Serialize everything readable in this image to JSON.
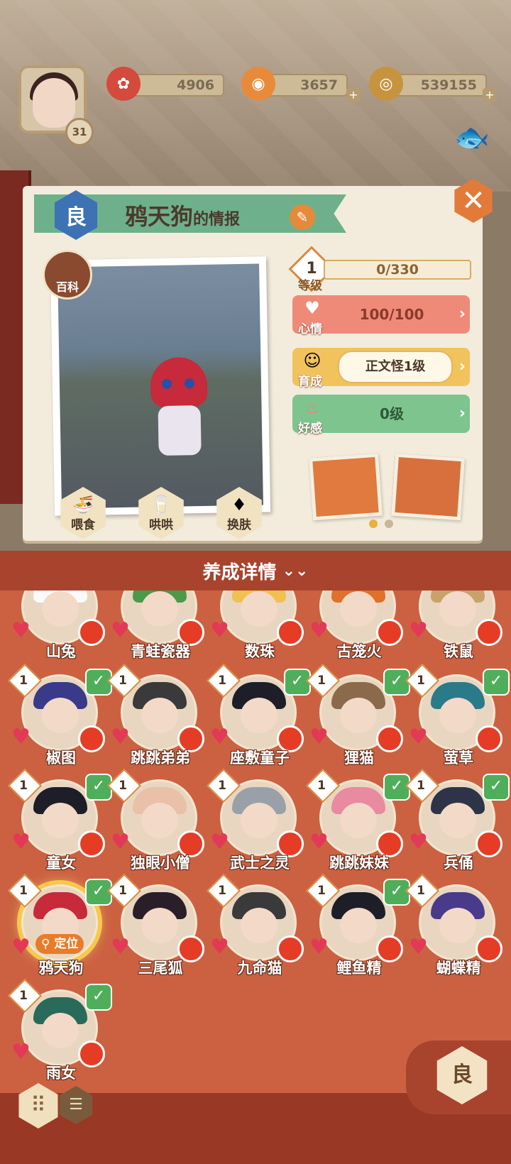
{
  "player": {
    "level": "31"
  },
  "resources": [
    {
      "name": "plum-token",
      "value": "4906",
      "color": "#d44a3c"
    },
    {
      "name": "soul-jade",
      "value": "3657",
      "color": "#e88a3a"
    },
    {
      "name": "coins",
      "value": "539155",
      "color": "#c6943f"
    }
  ],
  "info": {
    "rank": "良",
    "name": "鸦天狗",
    "suffix": "的情报",
    "close": "✕",
    "baike": "百科"
  },
  "actions": [
    {
      "label": "喂食",
      "icon": "bowl-icon"
    },
    {
      "label": "哄哄",
      "icon": "milk-icon"
    },
    {
      "label": "换肤",
      "icon": "skin-icon"
    }
  ],
  "stats": {
    "level": {
      "num": "1",
      "label": "等级",
      "value": "0/330"
    },
    "mood": {
      "label": "心情",
      "value": "100/100",
      "color": "#f08a78"
    },
    "growth": {
      "label": "育成",
      "value": "正文怪1级",
      "color": "#f2c25c"
    },
    "favor": {
      "label": "好感",
      "value": "0级",
      "color": "#7ec48f"
    }
  },
  "section": {
    "title": "养成详情"
  },
  "monsters": [
    {
      "name": "山兔",
      "level": "",
      "checked": false,
      "hair": "#fafafa"
    },
    {
      "name": "青蛙瓷器",
      "level": "",
      "checked": false,
      "hair": "#4a9a4a"
    },
    {
      "name": "数珠",
      "level": "",
      "checked": false,
      "hair": "#f0c050"
    },
    {
      "name": "古笼火",
      "level": "",
      "checked": false,
      "hair": "#e0702a"
    },
    {
      "name": "铁鼠",
      "level": "",
      "checked": false,
      "hair": "#c8a26a"
    },
    {
      "name": "椒图",
      "level": "1",
      "checked": true,
      "hair": "#3a3a8a"
    },
    {
      "name": "跳跳弟弟",
      "level": "1",
      "checked": false,
      "hair": "#3a3a3a"
    },
    {
      "name": "座敷童子",
      "level": "1",
      "checked": true,
      "hair": "#1e1e28"
    },
    {
      "name": "狸猫",
      "level": "1",
      "checked": true,
      "hair": "#8a6a4a"
    },
    {
      "name": "萤草",
      "level": "1",
      "checked": true,
      "hair": "#2a7a8a"
    },
    {
      "name": "童女",
      "level": "1",
      "checked": true,
      "hair": "#1e1e28"
    },
    {
      "name": "独眼小僧",
      "level": "1",
      "checked": false,
      "hair": "#e9c0a8"
    },
    {
      "name": "武士之灵",
      "level": "1",
      "checked": false,
      "hair": "#9aa0a8"
    },
    {
      "name": "跳跳妹妹",
      "level": "1",
      "checked": true,
      "hair": "#e88aa0"
    },
    {
      "name": "兵俑",
      "level": "1",
      "checked": true,
      "hair": "#2e3448"
    },
    {
      "name": "鸦天狗",
      "level": "1",
      "checked": true,
      "hair": "#c62a3b",
      "locate": "定位"
    },
    {
      "name": "三尾狐",
      "level": "1",
      "checked": false,
      "hair": "#2a1e28"
    },
    {
      "name": "九命猫",
      "level": "1",
      "checked": false,
      "hair": "#3a3a3a"
    },
    {
      "name": "鲤鱼精",
      "level": "1",
      "checked": true,
      "hair": "#1e1e28"
    },
    {
      "name": "蝴蝶精",
      "level": "1",
      "checked": false,
      "hair": "#4a3a8a"
    },
    {
      "name": "雨女",
      "level": "1",
      "checked": true,
      "hair": "#2a6a5a"
    }
  ],
  "filter": {
    "rank": "良"
  }
}
